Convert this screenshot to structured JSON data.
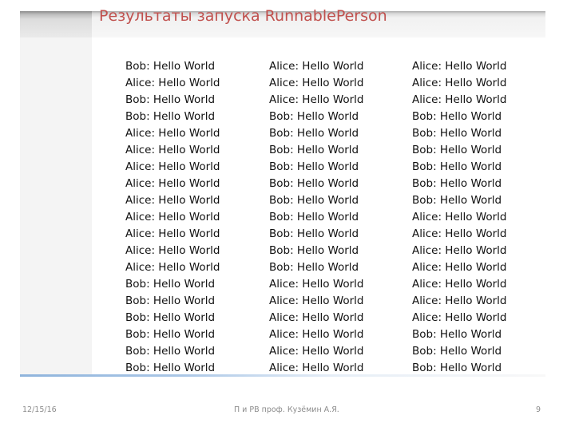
{
  "slide": {
    "title": "Результаты запуска RunnablePerson",
    "columns": [
      [
        "Bob: Hello World",
        "Alice: Hello World",
        "Bob: Hello World",
        "Bob: Hello World",
        "Alice: Hello World",
        "Alice: Hello World",
        "Alice: Hello World",
        "Alice: Hello World",
        "Alice: Hello World",
        "Alice: Hello World",
        "Alice: Hello World",
        "Alice: Hello World",
        "Alice: Hello World",
        "Bob: Hello World",
        "Bob: Hello World",
        "Bob: Hello World",
        "Bob: Hello World",
        "Bob: Hello World",
        "Bob: Hello World"
      ],
      [
        "Alice: Hello World",
        "Alice: Hello World",
        "Alice: Hello World",
        "Bob: Hello World",
        "Bob: Hello World",
        "Bob: Hello World",
        "Bob: Hello World",
        "Bob: Hello World",
        "Bob: Hello World",
        "Bob: Hello World",
        "Bob: Hello World",
        "Bob: Hello World",
        "Bob: Hello World",
        "Alice: Hello World",
        "Alice: Hello World",
        "Alice: Hello World",
        "Alice: Hello World",
        "Alice: Hello World",
        "Alice: Hello World"
      ],
      [
        "Alice: Hello World",
        "Alice: Hello World",
        "Alice: Hello World",
        "Bob: Hello World",
        "Bob: Hello World",
        "Bob: Hello World",
        "Bob: Hello World",
        "Bob: Hello World",
        "Bob: Hello World",
        "Alice: Hello World",
        "Alice: Hello World",
        "Alice: Hello World",
        "Alice: Hello World",
        "Alice: Hello World",
        "Alice: Hello World",
        "Alice: Hello World",
        "Bob: Hello World",
        "Bob: Hello World",
        "Bob: Hello World"
      ]
    ]
  },
  "footer": {
    "date": "12/15/16",
    "author": "П и РВ проф. Кузёмин А.Я.",
    "page_number": "9"
  }
}
